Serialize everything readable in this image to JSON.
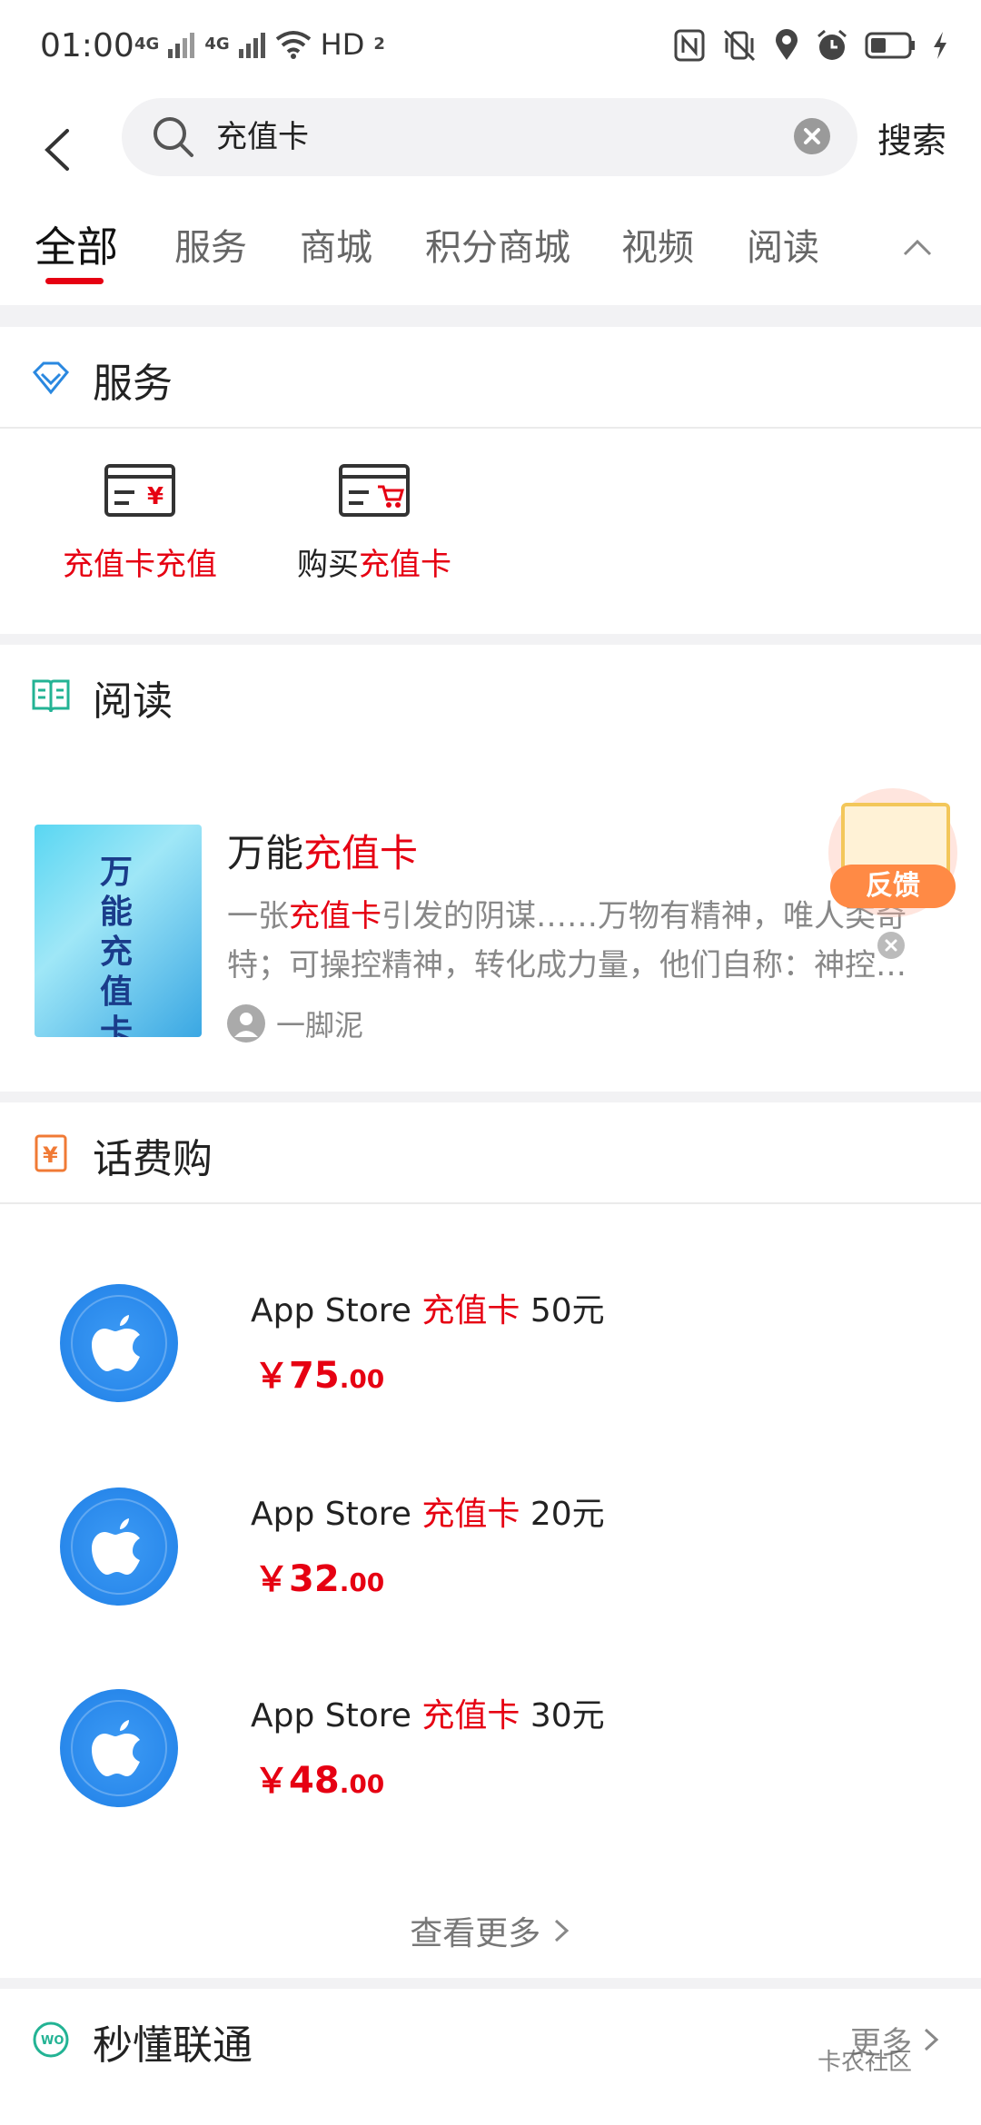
{
  "status_bar": {
    "time": "01:00",
    "network_1": "4G",
    "network_2": "4G",
    "hd": "HD",
    "hd_sub": "2",
    "icons": [
      "nfc-icon",
      "vibrate-icon",
      "location-icon",
      "alarm-icon",
      "battery-icon",
      "charging-icon"
    ]
  },
  "search": {
    "query": "充值卡",
    "button_label": "搜索"
  },
  "tabs": [
    "全部",
    "服务",
    "商城",
    "积分商城",
    "视频",
    "阅读"
  ],
  "service_section": {
    "title": "服务",
    "items": [
      {
        "label_red": "充值卡充值",
        "label_plain": ""
      },
      {
        "label_plain": "购买",
        "label_red": "充值卡"
      }
    ]
  },
  "reading_section": {
    "title": "阅读",
    "book": {
      "title_prefix": "万能",
      "title_highlight": "充值卡",
      "cover_text": "万能充值卡",
      "desc_prefix": "一张",
      "desc_highlight": "充值卡",
      "desc_rest": "引发的阴谋……万物有精神，唯人类奇特；可操控精神，转化成力量，他们自称：神控…",
      "author": "一脚泥"
    },
    "feedback_label": "反馈"
  },
  "phone_bill_section": {
    "title": "话费购",
    "products": [
      {
        "name_prefix": "App Store ",
        "name_highlight": "充值卡",
        "name_suffix": " 50元",
        "price_yen": "￥",
        "price_int": "75",
        "price_dec": ".00"
      },
      {
        "name_prefix": "App Store ",
        "name_highlight": "充值卡",
        "name_suffix": " 20元",
        "price_yen": "￥",
        "price_int": "32",
        "price_dec": ".00"
      },
      {
        "name_prefix": "App Store ",
        "name_highlight": "充值卡",
        "name_suffix": " 30元",
        "price_yen": "￥",
        "price_int": "48",
        "price_dec": ".00"
      }
    ],
    "more_label": "查看更多"
  },
  "unicom_section": {
    "title": "秒懂联通",
    "more_label": "更多"
  },
  "watermark": "卡农社区",
  "colors": {
    "accent_red": "#e60012",
    "apple_blue": "#1f7fe6",
    "feedback_orange": "#ff8a45"
  }
}
